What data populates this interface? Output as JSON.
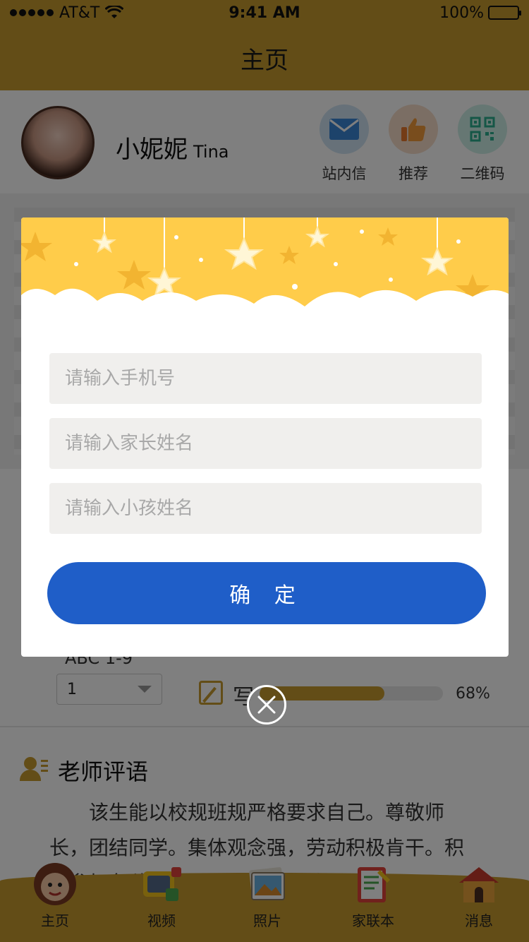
{
  "status_bar": {
    "carrier": "AT&T",
    "time": "9:41 AM",
    "battery": "100%"
  },
  "nav": {
    "title": "主页"
  },
  "profile": {
    "name": "小妮妮",
    "english_name": "Tina",
    "actions": [
      {
        "label": "站内信",
        "icon": "mail-icon"
      },
      {
        "label": "推荐",
        "icon": "thumbs-up-icon"
      },
      {
        "label": "二维码",
        "icon": "qr-code-icon"
      }
    ]
  },
  "stats": {
    "subject_label": "ABC 1-9",
    "select_value": "1",
    "write_label": "写",
    "progress": 0.68,
    "progress_text": "68%"
  },
  "teacher": {
    "title": "老师评语",
    "comment": "该生能以校规班规严格要求自己。尊敬师长，团结同学。集体观念强，劳动积极肯干。积极参加各种集体活动和社会实践活动。"
  },
  "tabbar": {
    "tabs": [
      {
        "label": "主页",
        "icon": "monkey-face-icon"
      },
      {
        "label": "视频",
        "icon": "tv-icon"
      },
      {
        "label": "照片",
        "icon": "photo-icon"
      },
      {
        "label": "家联本",
        "icon": "notebook-icon"
      },
      {
        "label": "消息",
        "icon": "doghouse-icon"
      }
    ]
  },
  "modal": {
    "phone_placeholder": "请输入手机号",
    "parent_placeholder": "请输入家长姓名",
    "child_placeholder": "请输入小孩姓名",
    "confirm_label": "确 定"
  },
  "colors": {
    "brand": "#c79a2e",
    "button": "#1f5ec8",
    "banner": "#ffcc4a"
  }
}
